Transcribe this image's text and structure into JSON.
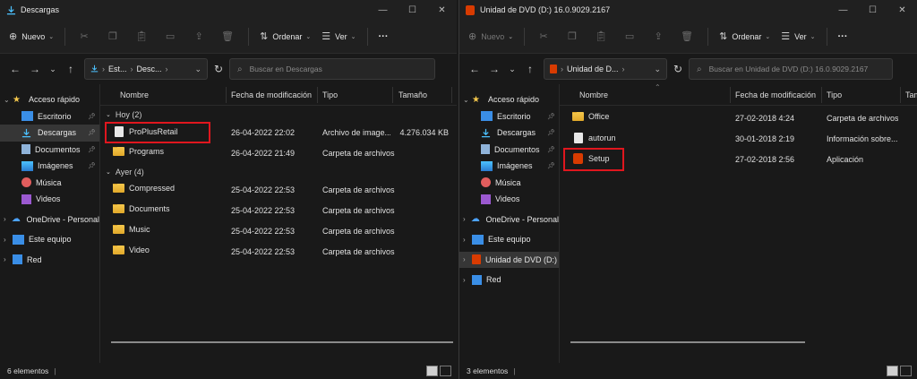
{
  "left": {
    "title": "Descargas",
    "toolbar": {
      "new": "Nuevo",
      "sort": "Ordenar",
      "view": "Ver",
      "more": "···"
    },
    "breadcrumb": [
      "Est...",
      "Desc..."
    ],
    "search_placeholder": "Buscar en Descargas",
    "columns": [
      "Nombre",
      "Fecha de modificación",
      "Tipo",
      "Tamaño"
    ],
    "nav": {
      "quick": "Acceso rápido",
      "items": [
        "Escritorio",
        "Descargas",
        "Documentos",
        "Imágenes",
        "Música",
        "Videos"
      ],
      "onedrive": "OneDrive - Personal",
      "pc": "Este equipo",
      "net": "Red"
    },
    "groups": [
      {
        "label": "Hoy (2)",
        "rows": [
          {
            "name": "ProPlusRetail",
            "date": "26-04-2022 22:02",
            "type": "Archivo de image...",
            "size": "4.276.034 KB"
          },
          {
            "name": "Programs",
            "date": "26-04-2022 21:49",
            "type": "Carpeta de archivos",
            "size": ""
          }
        ]
      },
      {
        "label": "Ayer (4)",
        "rows": [
          {
            "name": "Compressed",
            "date": "25-04-2022 22:53",
            "type": "Carpeta de archivos",
            "size": ""
          },
          {
            "name": "Documents",
            "date": "25-04-2022 22:53",
            "type": "Carpeta de archivos",
            "size": ""
          },
          {
            "name": "Music",
            "date": "25-04-2022 22:53",
            "type": "Carpeta de archivos",
            "size": ""
          },
          {
            "name": "Video",
            "date": "25-04-2022 22:53",
            "type": "Carpeta de archivos",
            "size": ""
          }
        ]
      }
    ],
    "status": "6 elementos"
  },
  "right": {
    "title": "Unidad de DVD (D:) 16.0.9029.2167",
    "toolbar": {
      "new": "Nuevo",
      "sort": "Ordenar",
      "view": "Ver",
      "more": "···"
    },
    "breadcrumb": [
      "Unidad de D..."
    ],
    "search_placeholder": "Buscar en Unidad de DVD (D:) 16.0.9029.2167",
    "columns": [
      "Nombre",
      "Fecha de modificación",
      "Tipo",
      "Tam"
    ],
    "nav": {
      "quick": "Acceso rápido",
      "items": [
        "Escritorio",
        "Descargas",
        "Documentos",
        "Imágenes",
        "Música",
        "Videos"
      ],
      "onedrive": "OneDrive - Personal",
      "pc": "Este equipo",
      "dvd": "Unidad de DVD (D:) ",
      "net": "Red"
    },
    "rows": [
      {
        "name": "Office",
        "date": "27-02-2018 4:24",
        "type": "Carpeta de archivos"
      },
      {
        "name": "autorun",
        "date": "30-01-2018 2:19",
        "type": "Información sobre..."
      },
      {
        "name": "Setup",
        "date": "27-02-2018 2:56",
        "type": "Aplicación"
      }
    ],
    "status": "3 elementos"
  },
  "colors": {
    "highlight": "#e0161e",
    "folder": "#f5c84c",
    "office": "#d83b01",
    "accent": "#4cc2ff"
  }
}
